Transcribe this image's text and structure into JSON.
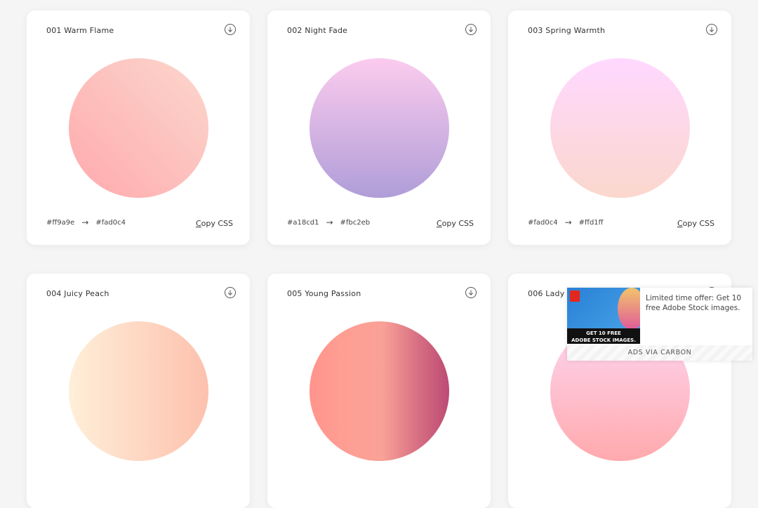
{
  "cards": [
    {
      "name": "001 Warm Flame",
      "from": "#ff9a9e",
      "to": "#fad0c4",
      "copy_prefix": "C",
      "copy_rest": "opy CSS",
      "gradient": "linear-gradient(45deg,#ff9a9e 0%,#fad0c4 99%,#fad0c4 100%)",
      "opacity": 0.85
    },
    {
      "name": "002 Night Fade",
      "from": "#a18cd1",
      "to": "#fbc2eb",
      "copy_prefix": "C",
      "copy_rest": "opy CSS",
      "gradient": "linear-gradient(to top,#a18cd1 0%,#fbc2eb 100%)",
      "opacity": 0.85
    },
    {
      "name": "003 Spring Warmth",
      "from": "#fad0c4",
      "to": "#ffd1ff",
      "copy_prefix": "C",
      "copy_rest": "opy CSS",
      "gradient": "linear-gradient(to top,#fad0c4 0%,#ffd1ff 100%)",
      "opacity": 0.85
    },
    {
      "name": "004 Juicy Peach",
      "gradient": "linear-gradient(to right,#ffecd2 0%,#fcb69f 100%)",
      "opacity": 0.85
    },
    {
      "name": "005 Young Passion",
      "gradient": "linear-gradient(to right,#ff8177 0%,#ff867a 0%,#ff8c7f 21%,#f99185 52%,#cf556c 78%,#b12a5b 100%)",
      "opacity": 0.85
    },
    {
      "name": "006 Lady Lips",
      "gradient": "linear-gradient(to top,#ff9a9e 0%,#fecfef 99%,#fecfef 100%)",
      "opacity": 0.85
    }
  ],
  "arrow": "→",
  "ad": {
    "image_line1": "GET 10 FREE",
    "image_line2": "ADOBE STOCK IMAGES.",
    "text": "Limited time offer: Get 10 free Adobe Stock images.",
    "footer": "ADS VIA CARBON"
  }
}
